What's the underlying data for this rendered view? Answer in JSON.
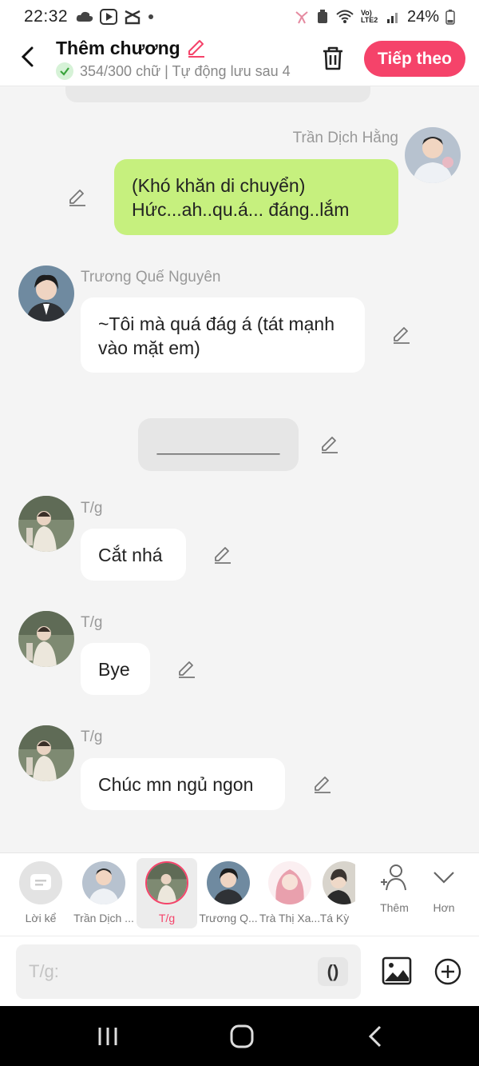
{
  "status_bar": {
    "time": "22:32",
    "battery": "24%",
    "network": "Vo) LTE2"
  },
  "header": {
    "title": "Thêm chương",
    "subtitle": "354/300 chữ | Tự động lưu sau 4",
    "next_label": "Tiếp theo"
  },
  "messages": [
    {
      "sender": "Trần Dịch Hằng",
      "text": "(Khó khăn di chuyển)\nHức...ah..qu.á... đáng..lắm",
      "side": "right"
    },
    {
      "sender": "Trương Quế Nguyên",
      "text": "~Tôi mà quá đág á (tát mạnh vào mặt em)",
      "side": "left"
    },
    {
      "sender": "",
      "text": "____________",
      "side": "center"
    },
    {
      "sender": "T/g",
      "text": "Cắt nhá",
      "side": "left"
    },
    {
      "sender": "T/g",
      "text": "Bye",
      "side": "left"
    },
    {
      "sender": "T/g",
      "text": "Chúc mn ngủ ngon",
      "side": "left"
    }
  ],
  "characters": [
    {
      "label": "Lời kể"
    },
    {
      "label": "Trần Dịch ..."
    },
    {
      "label": "T/g"
    },
    {
      "label": "Trương Q..."
    },
    {
      "label": "Trà Thị Xa..."
    },
    {
      "label": "Tá Kỳ"
    }
  ],
  "tools": {
    "add_label": "Thêm",
    "more_label": "Hơn"
  },
  "input": {
    "placeholder": "T/g:",
    "paren_label": "()"
  },
  "colors": {
    "accent": "#f5436a",
    "green_bubble": "#c6f07e"
  }
}
